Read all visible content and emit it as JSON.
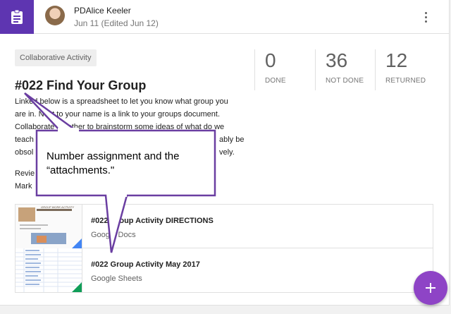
{
  "header": {
    "author": "PDAlice Keeler",
    "date": "Jun 11 (Edited Jun 12)",
    "icon": "assignment-icon",
    "menu_icon": "more-vert-icon"
  },
  "topic": "Collaborative Activity",
  "stats": [
    {
      "value": "0",
      "label": "DONE"
    },
    {
      "value": "36",
      "label": "NOT DONE"
    },
    {
      "value": "12",
      "label": "RETURNED"
    }
  ],
  "assignment": {
    "title": "#022 Find Your Group",
    "description_lines": [
      "Linked below is a spreadsheet to let you know what group you",
      "are in. Next to your name is a link to your groups document.",
      "Collaborate together to brainstorm some ideas of what do we",
      "teach",
      "obsol"
    ],
    "line4_tail": "ably be",
    "line5_tail": "vely.",
    "review_line": "Revie",
    "mark_line": "Mark"
  },
  "attachments": [
    {
      "title": "#022 Group Activity DIRECTIONS",
      "type": "Google Docs",
      "thumb_heading": "GROUP WORK ACTIVITY",
      "accent": "#4285f4"
    },
    {
      "title": "#022 Group Activity May 2017",
      "type": "Google Sheets",
      "accent": "#0f9d58"
    }
  ],
  "callout": {
    "line1": "Number assignment and the",
    "line2": "“attachments.\"",
    "color": "#6a3ea1"
  },
  "fab": {
    "icon": "plus-icon",
    "color": "#8e44c6"
  },
  "colors": {
    "header_accent": "#5e35b1"
  }
}
